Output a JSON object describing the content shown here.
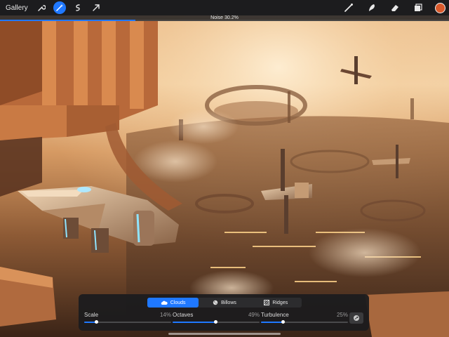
{
  "toolbar": {
    "gallery_label": "Gallery",
    "left_tools": [
      {
        "name": "actions-wrench-icon",
        "active": false
      },
      {
        "name": "adjustments-wand-icon",
        "active": true
      },
      {
        "name": "selection-icon",
        "active": false
      },
      {
        "name": "transform-arrow-icon",
        "active": false
      }
    ],
    "right_tools": [
      "brush-icon",
      "smudge-icon",
      "eraser-icon",
      "layers-icon"
    ],
    "current_color": "#d9592b"
  },
  "adjustment": {
    "title": "Noise 30.2%",
    "amount_percent": 30.2
  },
  "noise_panel": {
    "tabs": [
      {
        "label": "Clouds",
        "icon": "cloud-icon",
        "active": true
      },
      {
        "label": "Billows",
        "icon": "billows-icon",
        "active": false
      },
      {
        "label": "Ridges",
        "icon": "ridges-icon",
        "active": false
      }
    ],
    "sliders": [
      {
        "label": "Scale",
        "value_text": "14%",
        "value": 14
      },
      {
        "label": "Octaves",
        "value_text": "49%",
        "value": 49
      },
      {
        "label": "Turbulence",
        "value_text": "25%",
        "value": 25
      }
    ],
    "seed_button_icon": "refresh-seed-icon"
  },
  "colors": {
    "accent": "#1f78ff",
    "toolbar_bg": "#1c1c1e"
  }
}
